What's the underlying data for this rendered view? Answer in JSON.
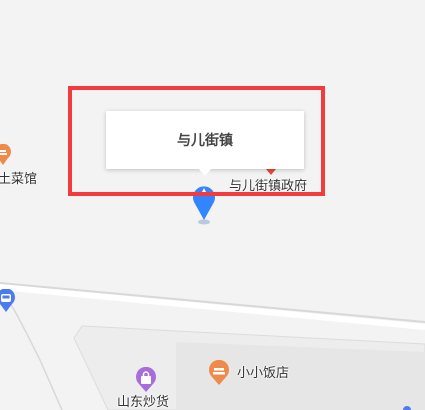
{
  "callout": {
    "title": "与儿街镇"
  },
  "pois": {
    "restaurant_left": {
      "label": "土菜馆",
      "icon": "restaurant-icon",
      "color": "#f08a4b"
    },
    "gov": {
      "label": "与儿街镇政府",
      "icon": "government-icon",
      "color": "#e54b3c"
    },
    "small_restaurant": {
      "label": "小小饭店",
      "icon": "restaurant-icon",
      "color": "#f08a4b"
    },
    "shop": {
      "label": "山东炒货",
      "icon": "shopping-bag-icon",
      "color": "#a86cdb"
    },
    "bus": {
      "icon": "bus-stop-icon",
      "color": "#4b7bec"
    }
  },
  "marker": {
    "icon": "location-pin-icon",
    "color": "#3385ff"
  },
  "highlight_color": "#f33b3f"
}
